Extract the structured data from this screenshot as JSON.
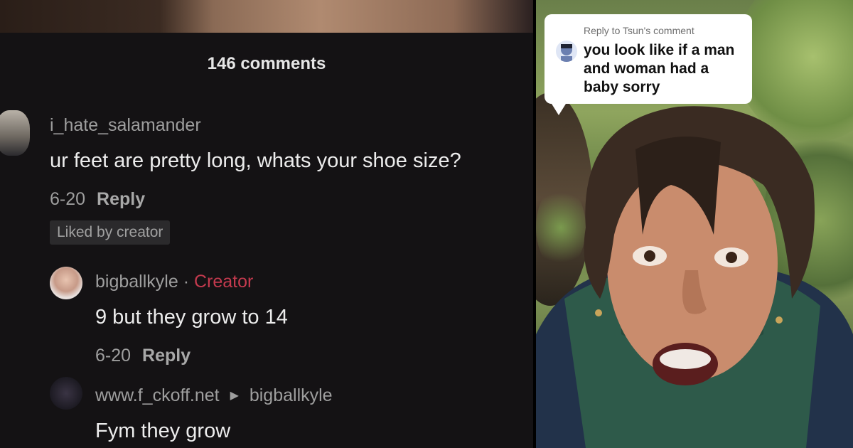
{
  "left_panel": {
    "comment_count": "146 comments",
    "comments": [
      {
        "username": "i_hate_salamander",
        "text": "ur feet are pretty long, whats your shoe size?",
        "date": "6-20",
        "reply_label": "Reply",
        "liked_label": "Liked by creator"
      },
      {
        "username": "bigballkyle",
        "separator": "·",
        "badge": "Creator",
        "text": "9 but they grow to 14",
        "date": "6-20",
        "reply_label": "Reply"
      },
      {
        "username": "www.f_ckoff.net",
        "reply_to": "bigballkyle",
        "text": "Fym they grow"
      }
    ]
  },
  "right_panel": {
    "reply_label": "Reply to Tsun's comment",
    "comment_text": "you look like if a man and woman had a baby sorry"
  },
  "colors": {
    "background": "#141214",
    "creator_badge": "#c43a4e",
    "muted_text": "#9e9e9e"
  }
}
